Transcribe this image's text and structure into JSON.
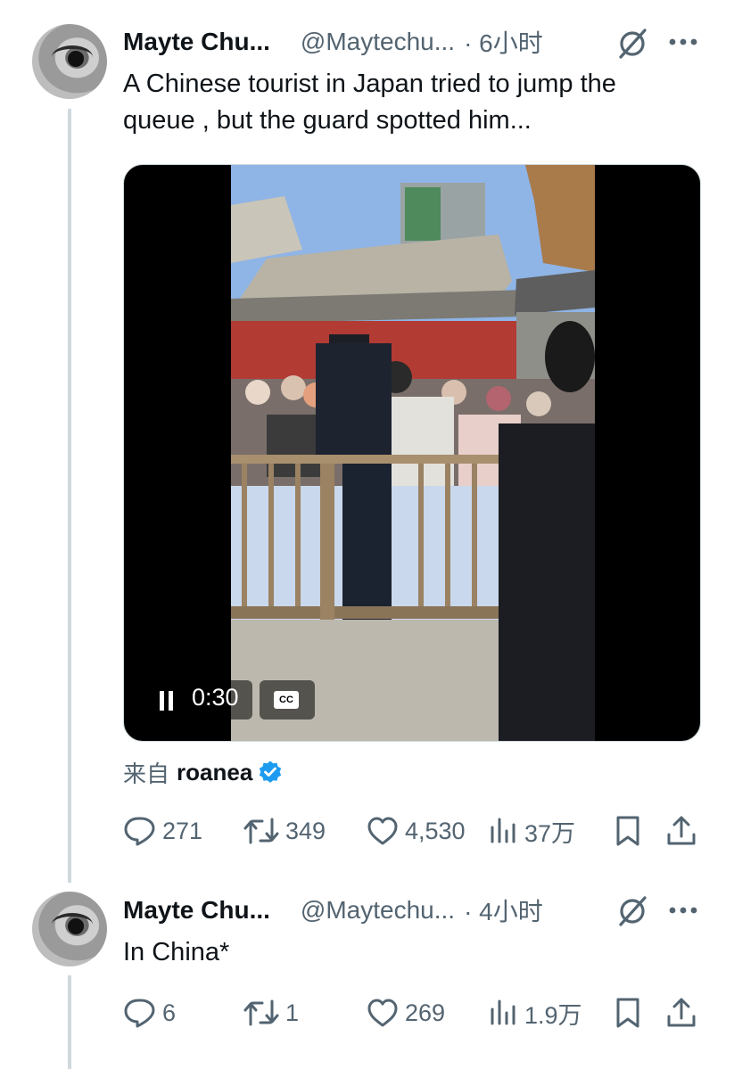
{
  "tweets": [
    {
      "author_name": "Mayte Chu...",
      "handle": "@Maytechu...",
      "time": "· 6小时",
      "text_line1": "A Chinese tourist in Japan tried to jump the",
      "text_line2": "queue , but the guard spotted him...",
      "video": {
        "elapsed": "0:30",
        "cc_label": "CC",
        "state": "playing"
      },
      "via_label": "来自",
      "via_user": "roanea",
      "replies": "271",
      "retweets": "349",
      "likes": "4,530",
      "views": "37万"
    },
    {
      "author_name": "Mayte Chu...",
      "handle": "@Maytechu...",
      "time": "· 4小时",
      "text_line1": "In China*",
      "replies": "6",
      "retweets": "1",
      "likes": "269",
      "views": "1.9万"
    }
  ],
  "icons": {
    "reply": "reply-icon",
    "retweet": "retweet-icon",
    "like": "heart-icon",
    "views": "views-icon",
    "bookmark": "bookmark-icon",
    "share": "share-icon",
    "grok": "grok-icon",
    "more": "more-icon",
    "verified": "verified-icon",
    "pause": "pause-icon"
  },
  "colors": {
    "text": "#0f1419",
    "secondary": "#536471",
    "verified": "#1d9bf0",
    "thread_line": "#cfd9de"
  }
}
